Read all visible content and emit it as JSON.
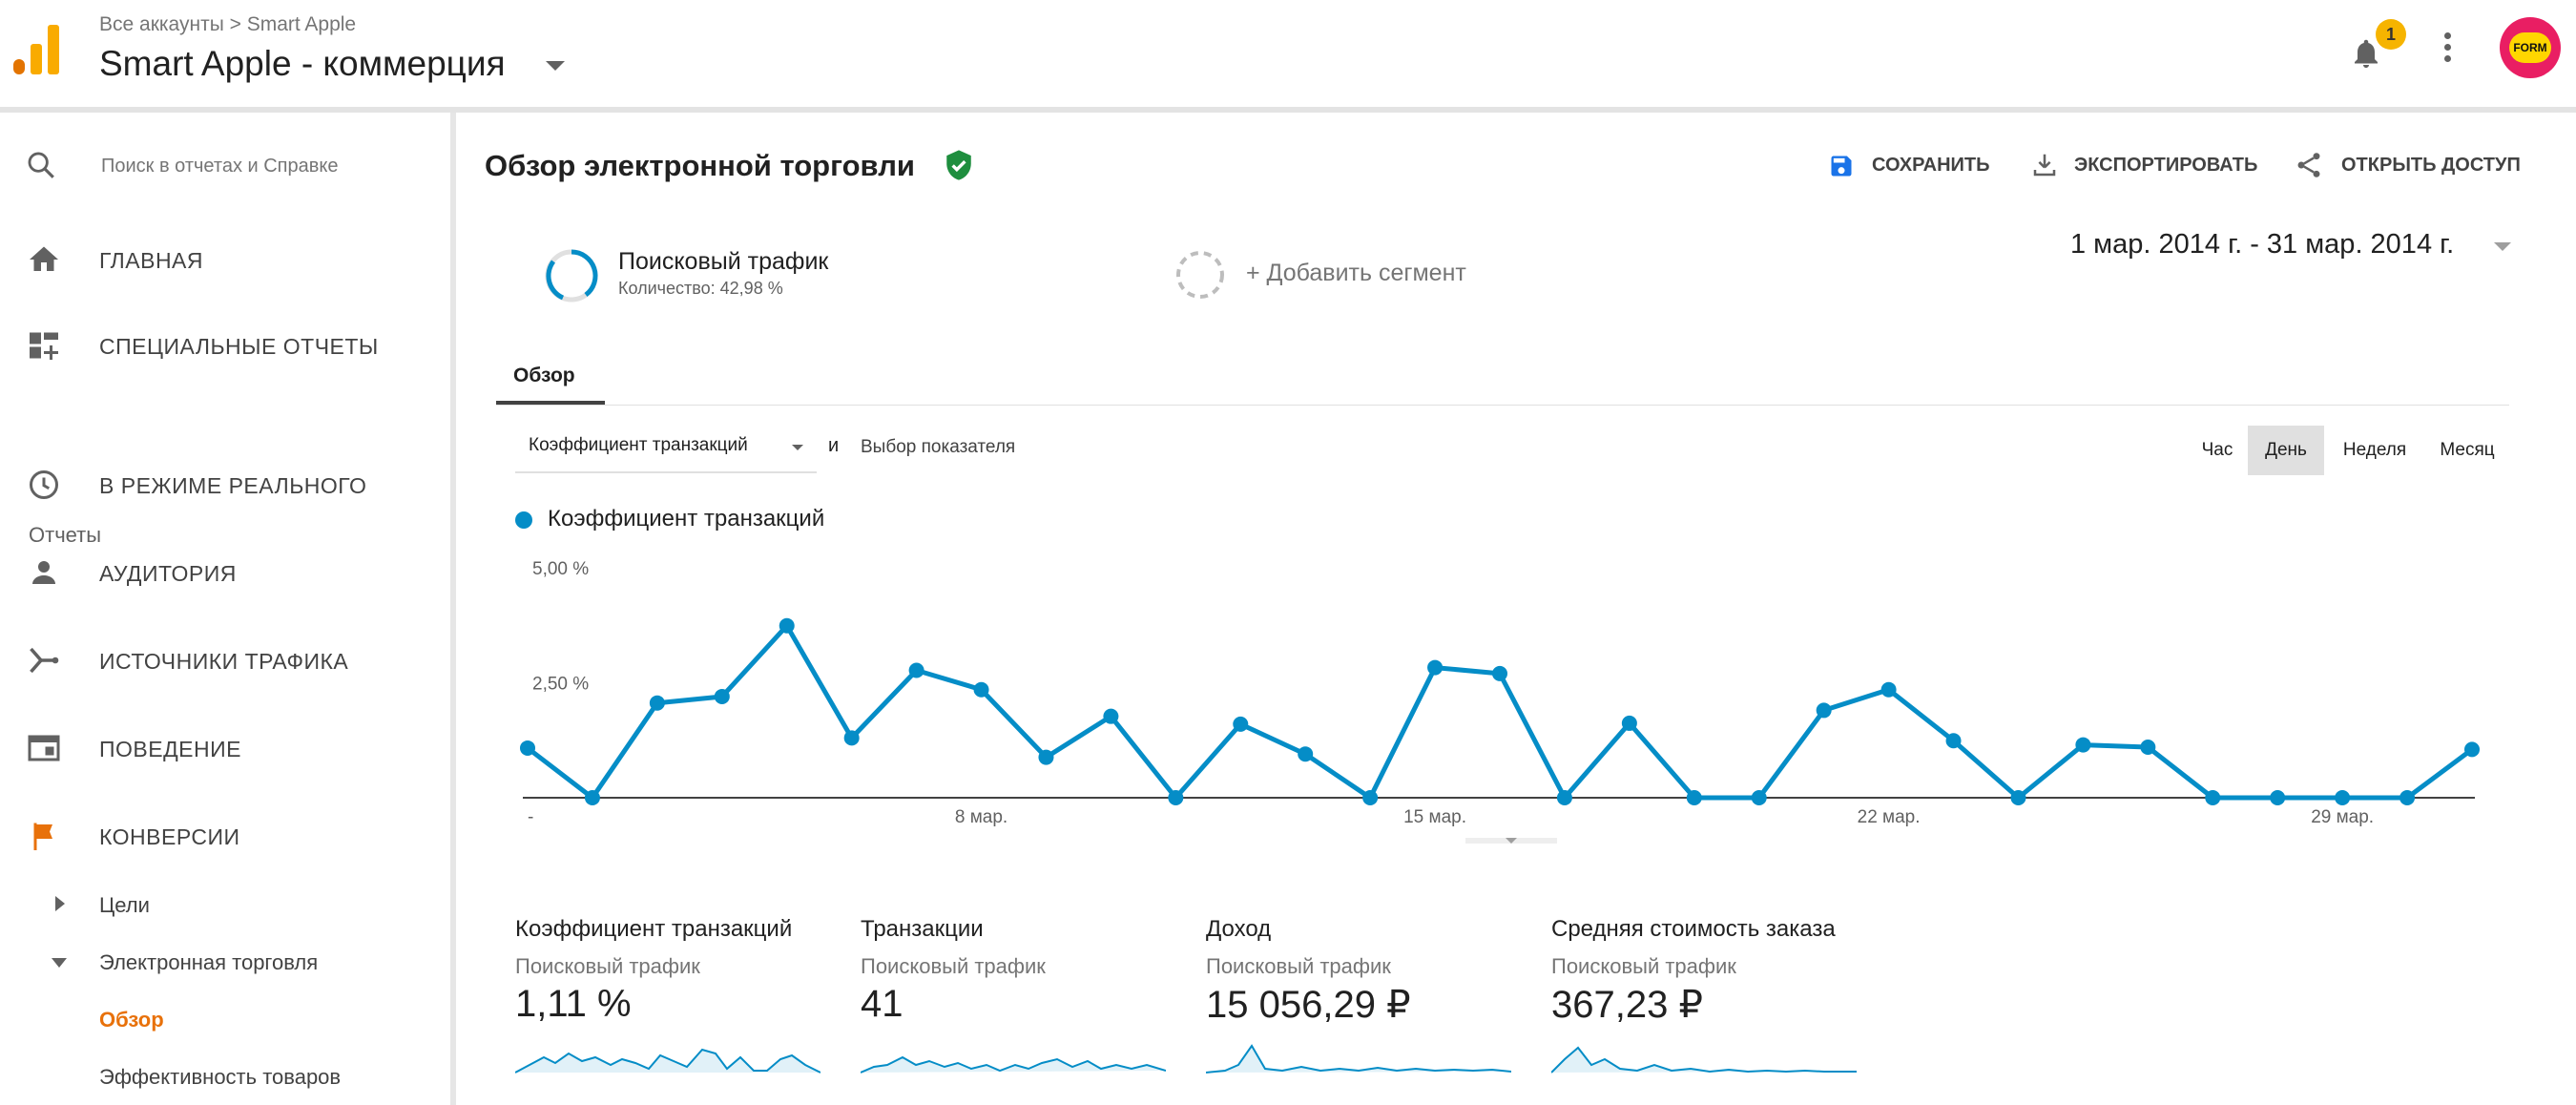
{
  "header": {
    "breadcrumb": "Все аккаунты > Smart Apple",
    "property_title": "Smart Apple - коммерция",
    "notification_count": "1",
    "avatar_text": "FORM"
  },
  "search": {
    "placeholder": "Поиск в отчетах и Справке"
  },
  "sidebar": {
    "nav": [
      {
        "label": "ГЛАВНАЯ",
        "icon": "home-icon"
      },
      {
        "label": "СПЕЦИАЛЬНЫЕ ОТЧЕТЫ",
        "icon": "custom-reports-icon"
      }
    ],
    "reports_heading": "Отчеты",
    "reports": [
      {
        "label": "В РЕЖИМЕ РЕАЛЬНОГО",
        "icon": "clock-icon"
      },
      {
        "label": "АУДИТОРИЯ",
        "icon": "person-icon"
      },
      {
        "label": "ИСТОЧНИКИ ТРАФИКА",
        "icon": "acquisition-icon"
      },
      {
        "label": "ПОВЕДЕНИЕ",
        "icon": "behavior-icon"
      },
      {
        "label": "КОНВЕРСИИ",
        "icon": "flag-icon"
      }
    ],
    "sub_items": [
      {
        "label": "Цели",
        "state": "collapsed"
      },
      {
        "label": "Электронная торговля",
        "state": "expanded"
      },
      {
        "label": "Обзор",
        "state": "active"
      },
      {
        "label": "Эффективность товаров",
        "state": "normal"
      }
    ],
    "accent_color": "#e8710a"
  },
  "report": {
    "title": "Обзор электронной торговли",
    "actions": {
      "save": "СОХРАНИТЬ",
      "export": "ЭКСПОРТИРОВАТЬ",
      "share": "ОТКРЫТЬ ДОСТУП"
    },
    "date_range": "1 мар. 2014 г. - 31 мар. 2014 г.",
    "segment": {
      "name": "Поисковый трафик",
      "subtitle": "Количество: 42,98 %"
    },
    "add_segment": "+ Добавить сегмент",
    "tab": "Обзор",
    "metric_selector": "Коэффициент транзакций",
    "and_label": "и",
    "pick_metric": "Выбор показателя",
    "granularity": [
      "Час",
      "День",
      "Неделя",
      "Месяц"
    ],
    "granularity_selected": "День"
  },
  "chart_data": {
    "type": "line",
    "series": [
      {
        "name": "Коэффициент транзакций",
        "color": "#058dc7",
        "x": [
          1,
          2,
          3,
          4,
          5,
          6,
          7,
          8,
          9,
          10,
          11,
          12,
          13,
          14,
          15,
          16,
          17,
          18,
          19,
          20,
          21,
          22,
          23,
          24,
          25,
          26,
          27,
          28,
          29,
          30,
          31
        ],
        "values": [
          1.08,
          0.0,
          2.06,
          2.2,
          3.74,
          1.3,
          2.77,
          2.35,
          0.88,
          1.77,
          0.0,
          1.6,
          0.95,
          0.0,
          2.83,
          2.7,
          0.0,
          1.62,
          0.0,
          0.0,
          1.9,
          2.35,
          1.24,
          0.0,
          1.15,
          1.1,
          0.0,
          0.0,
          0.0,
          0.0,
          1.05
        ]
      }
    ],
    "y_ticks": [
      "5,00 %",
      "2,50 %"
    ],
    "x_ticks": [
      {
        "day": 1,
        "label": "..."
      },
      {
        "day": 8,
        "label": "8 мар."
      },
      {
        "day": 15,
        "label": "15 мар."
      },
      {
        "day": 22,
        "label": "22 мар."
      },
      {
        "day": 29,
        "label": "29 мар."
      }
    ],
    "ylim": [
      0,
      5
    ],
    "legend": "Коэффициент транзакций",
    "legend_position": "top-left",
    "grid": false
  },
  "scorecards": [
    {
      "title": "Коэффициент транзакций",
      "segment": "Поисковый трафик",
      "value": "1,11 %"
    },
    {
      "title": "Транзакции",
      "segment": "Поисковый трафик",
      "value": "41"
    },
    {
      "title": "Доход",
      "segment": "Поисковый трафик",
      "value": "15 056,29 ₽"
    },
    {
      "title": "Средняя стоимость заказа",
      "segment": "Поисковый трафик",
      "value": "367,23 ₽"
    }
  ],
  "colors": {
    "line": "#058dc7",
    "logo_orange": "#f9ab00",
    "logo_dark_orange": "#e37400",
    "verified_green": "#1e8e3e",
    "save_blue": "#1a73e8"
  }
}
